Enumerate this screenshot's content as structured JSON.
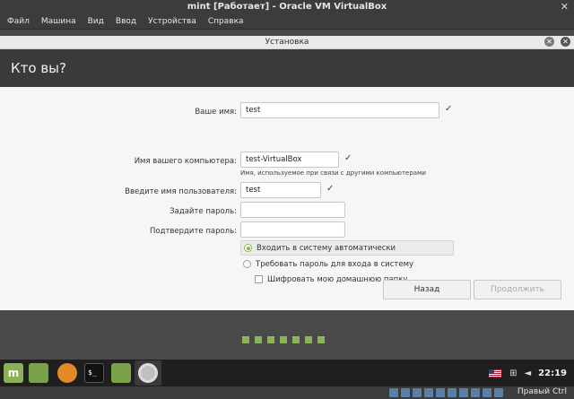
{
  "vbox": {
    "title": "mint [Работает] - Oracle VM VirtualBox",
    "menu": [
      "Файл",
      "Машина",
      "Вид",
      "Ввод",
      "Устройства",
      "Справка"
    ],
    "host_key": "Правый Ctrl"
  },
  "installer": {
    "window_title": "Установка",
    "heading": "Кто вы?",
    "fields": {
      "name_label": "Ваше имя:",
      "name_value": "test",
      "computer_label": "Имя вашего компьютера:",
      "computer_value": "test-VirtualBox",
      "computer_hint": "Имя, используемое при связи с другими компьютерами",
      "username_label": "Введите имя пользователя:",
      "username_value": "test",
      "password_label": "Задайте пароль:",
      "confirm_label": "Подтвердите пароль:"
    },
    "options": {
      "auto_login": "Входить в систему автоматически",
      "require_password": "Требовать пароль для входа в систему",
      "encrypt_home": "Шифровать мою домашнюю папку"
    },
    "buttons": {
      "back": "Назад",
      "continue": "Продолжить"
    }
  },
  "taskbar": {
    "clock": "22:19"
  },
  "colors": {
    "accent": "#8bb158"
  }
}
